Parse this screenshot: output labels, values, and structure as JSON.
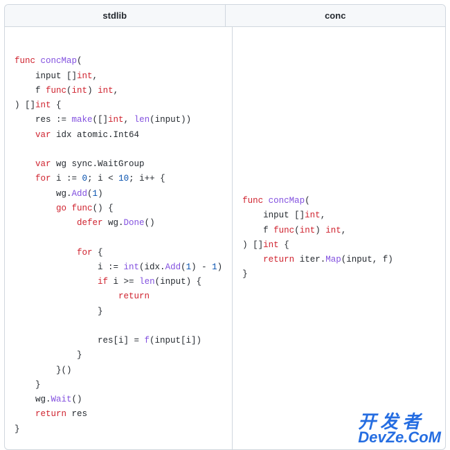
{
  "headers": {
    "left": "stdlib",
    "right": "conc"
  },
  "code": {
    "stdlib": {
      "tokens": [
        {
          "t": "\n"
        },
        {
          "t": "func ",
          "c": "kw"
        },
        {
          "t": "concMap",
          "c": "fn"
        },
        {
          "t": "(\n"
        },
        {
          "t": "    input []"
        },
        {
          "t": "int",
          "c": "kw"
        },
        {
          "t": ",\n"
        },
        {
          "t": "    f "
        },
        {
          "t": "func",
          "c": "kw"
        },
        {
          "t": "("
        },
        {
          "t": "int",
          "c": "kw"
        },
        {
          "t": ") "
        },
        {
          "t": "int",
          "c": "kw"
        },
        {
          "t": ",\n"
        },
        {
          "t": ") []"
        },
        {
          "t": "int",
          "c": "kw"
        },
        {
          "t": " {\n"
        },
        {
          "t": "    res := "
        },
        {
          "t": "make",
          "c": "fn"
        },
        {
          "t": "([]"
        },
        {
          "t": "int",
          "c": "kw"
        },
        {
          "t": ", "
        },
        {
          "t": "len",
          "c": "fn"
        },
        {
          "t": "(input))\n"
        },
        {
          "t": "    "
        },
        {
          "t": "var",
          "c": "kw"
        },
        {
          "t": " idx atomic.Int64\n"
        },
        {
          "t": "\n"
        },
        {
          "t": "    "
        },
        {
          "t": "var",
          "c": "kw"
        },
        {
          "t": " wg sync.WaitGroup\n"
        },
        {
          "t": "    "
        },
        {
          "t": "for",
          "c": "kw"
        },
        {
          "t": " i := "
        },
        {
          "t": "0",
          "c": "num"
        },
        {
          "t": "; i < "
        },
        {
          "t": "10",
          "c": "num"
        },
        {
          "t": "; i++ {\n"
        },
        {
          "t": "        wg."
        },
        {
          "t": "Add",
          "c": "fn"
        },
        {
          "t": "("
        },
        {
          "t": "1",
          "c": "num"
        },
        {
          "t": ")\n"
        },
        {
          "t": "        "
        },
        {
          "t": "go",
          "c": "kw"
        },
        {
          "t": " "
        },
        {
          "t": "func",
          "c": "kw"
        },
        {
          "t": "() {\n"
        },
        {
          "t": "            "
        },
        {
          "t": "defer",
          "c": "kw"
        },
        {
          "t": " wg."
        },
        {
          "t": "Done",
          "c": "fn"
        },
        {
          "t": "()\n"
        },
        {
          "t": "\n"
        },
        {
          "t": "            "
        },
        {
          "t": "for",
          "c": "kw"
        },
        {
          "t": " {\n"
        },
        {
          "t": "                i := "
        },
        {
          "t": "int",
          "c": "fn"
        },
        {
          "t": "(idx."
        },
        {
          "t": "Add",
          "c": "fn"
        },
        {
          "t": "("
        },
        {
          "t": "1",
          "c": "num"
        },
        {
          "t": ") - "
        },
        {
          "t": "1",
          "c": "num"
        },
        {
          "t": ")\n"
        },
        {
          "t": "                "
        },
        {
          "t": "if",
          "c": "kw"
        },
        {
          "t": " i >= "
        },
        {
          "t": "len",
          "c": "fn"
        },
        {
          "t": "(input) {\n"
        },
        {
          "t": "                    "
        },
        {
          "t": "return",
          "c": "kw"
        },
        {
          "t": "\n"
        },
        {
          "t": "                }\n"
        },
        {
          "t": "\n"
        },
        {
          "t": "                res[i] = "
        },
        {
          "t": "f",
          "c": "fn"
        },
        {
          "t": "(input[i])\n"
        },
        {
          "t": "            }\n"
        },
        {
          "t": "        }()\n"
        },
        {
          "t": "    }\n"
        },
        {
          "t": "    wg."
        },
        {
          "t": "Wait",
          "c": "fn"
        },
        {
          "t": "()\n"
        },
        {
          "t": "    "
        },
        {
          "t": "return",
          "c": "kw"
        },
        {
          "t": " res\n"
        },
        {
          "t": "}\n"
        }
      ]
    },
    "conc": {
      "tokens": [
        {
          "t": "func ",
          "c": "kw"
        },
        {
          "t": "concMap",
          "c": "fn"
        },
        {
          "t": "(\n"
        },
        {
          "t": "    input []"
        },
        {
          "t": "int",
          "c": "kw"
        },
        {
          "t": ",\n"
        },
        {
          "t": "    f "
        },
        {
          "t": "func",
          "c": "kw"
        },
        {
          "t": "("
        },
        {
          "t": "int",
          "c": "kw"
        },
        {
          "t": ") "
        },
        {
          "t": "int",
          "c": "kw"
        },
        {
          "t": ",\n"
        },
        {
          "t": ") []"
        },
        {
          "t": "int",
          "c": "kw"
        },
        {
          "t": " {\n"
        },
        {
          "t": "    "
        },
        {
          "t": "return",
          "c": "kw"
        },
        {
          "t": " iter."
        },
        {
          "t": "Map",
          "c": "fn"
        },
        {
          "t": "(input, f)\n"
        },
        {
          "t": "}\n"
        }
      ]
    }
  },
  "watermark": {
    "line1": "开发者",
    "line2": "DevZe.CoM"
  }
}
